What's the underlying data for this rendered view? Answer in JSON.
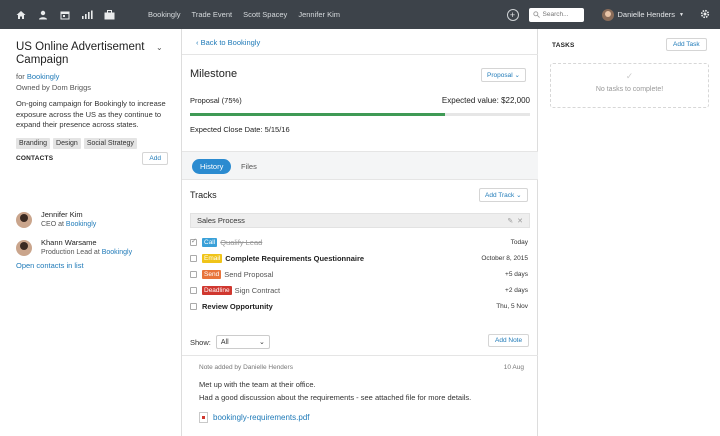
{
  "topbar": {
    "nav_icons": [
      "home-icon",
      "person-icon",
      "calendar-icon",
      "bar-chart-icon",
      "briefcase-icon"
    ],
    "links": [
      "Bookingly",
      "Trade Event",
      "Scott Spacey",
      "Jennifer Kim"
    ],
    "search_placeholder": "Search...",
    "user_name": "Danielle Henders"
  },
  "campaign": {
    "title": "US Online Advertisement Campaign",
    "for_prefix": "for",
    "for_company": "Bookingly",
    "owner": "Owned by Dom Briggs",
    "description": "On-going campaign for Bookingly to increase exposure across the US as they continue to expand their presence across states.",
    "tags": [
      "Branding",
      "Design",
      "Social Strategy"
    ]
  },
  "contacts": {
    "heading": "CONTACTS",
    "add_label": "Add",
    "items": [
      {
        "name": "Jennifer Kim",
        "role_prefix": "CEO at",
        "company": "Bookingly"
      },
      {
        "name": "Khann Warsame",
        "role_prefix": "Production Lead at",
        "company": "Bookingly"
      }
    ],
    "open_list_label": "Open contacts in list"
  },
  "milestone": {
    "back_label": "‹ Back to Bookingly",
    "title": "Milestone",
    "stage": "Proposal",
    "progress_label": "Proposal (75%)",
    "progress_value": 0.75,
    "expected_value": "Expected value: $22,000",
    "close_date": "Expected Close Date: 5/15/16"
  },
  "tabs": {
    "history": "History",
    "files": "Files"
  },
  "tracks": {
    "title": "Tracks",
    "add_label": "Add Track",
    "group": "Sales Process",
    "items": [
      {
        "badge": "Call",
        "badge_color": "#3aa0d8",
        "label": "Qualify Lead",
        "due": "Today",
        "done": true
      },
      {
        "badge": "Email",
        "badge_color": "#f0c419",
        "label": "Complete Requirements Questionnaire",
        "due": "October 8, 2015",
        "done": false
      },
      {
        "badge": "Send",
        "badge_color": "#e8743b",
        "label": "Send Proposal",
        "due": "+5 days",
        "done": false
      },
      {
        "badge": "Deadline",
        "badge_color": "#d0372f",
        "label": "Sign Contract",
        "due": "+2 days",
        "done": false
      },
      {
        "badge": "",
        "badge_color": "",
        "label": "Review Opportunity",
        "due": "Thu, 5 Nov",
        "done": false
      }
    ]
  },
  "notes": {
    "show_label": "Show:",
    "filter_value": "All",
    "add_label": "Add Note",
    "author": "Note added by Danielle Henders",
    "date": "10 Aug",
    "line1": "Met up with the team at their office.",
    "line2": "Had a good discussion about the requirements - see attached file for more details.",
    "attachment": "bookingly-requirements.pdf"
  },
  "tasks": {
    "heading": "TASKS",
    "add_label": "Add Task",
    "empty_text": "No tasks to complete!"
  }
}
